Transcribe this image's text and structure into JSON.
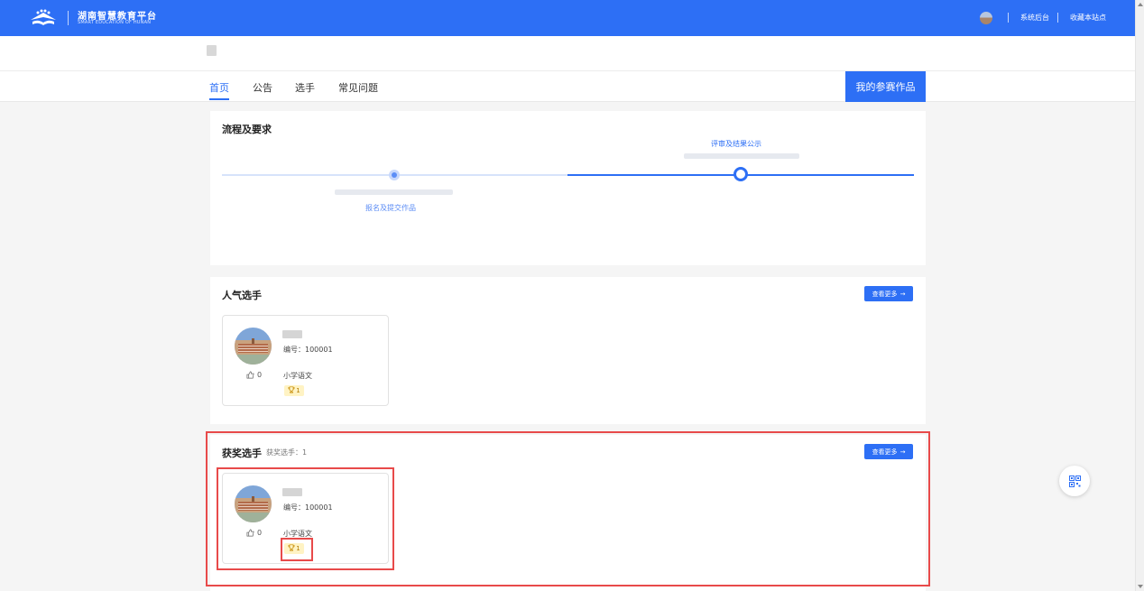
{
  "header": {
    "logo_title": "湖南智慧教育平台",
    "logo_subtitle": "SMART EDUCATION OF HUNAN",
    "links": [
      "系统后台",
      "收藏本站点"
    ]
  },
  "nav": {
    "tabs": [
      "首页",
      "公告",
      "选手",
      "常见问题"
    ],
    "active": "首页",
    "my_works_button": "我的参赛作品"
  },
  "process": {
    "title": "流程及要求",
    "steps": [
      {
        "label": "报名及提交作品",
        "state": "done"
      },
      {
        "label": "评审及结果公示",
        "state": "current"
      }
    ]
  },
  "popular": {
    "title": "人气选手",
    "more_button": "查看更多",
    "players": [
      {
        "id_text": "编号：100001",
        "likes": "0",
        "subject": "小学语文",
        "award_count": "1"
      }
    ]
  },
  "awarded": {
    "title": "获奖选手",
    "count_text": "获奖选手：1",
    "more_button": "查看更多",
    "players": [
      {
        "id_text": "编号：100001",
        "likes": "0",
        "subject": "小学语文",
        "award_count": "1"
      }
    ]
  },
  "colors": {
    "primary": "#2d6ff5",
    "highlight_border": "#e84a4a",
    "badge_bg": "#fff3c4"
  }
}
